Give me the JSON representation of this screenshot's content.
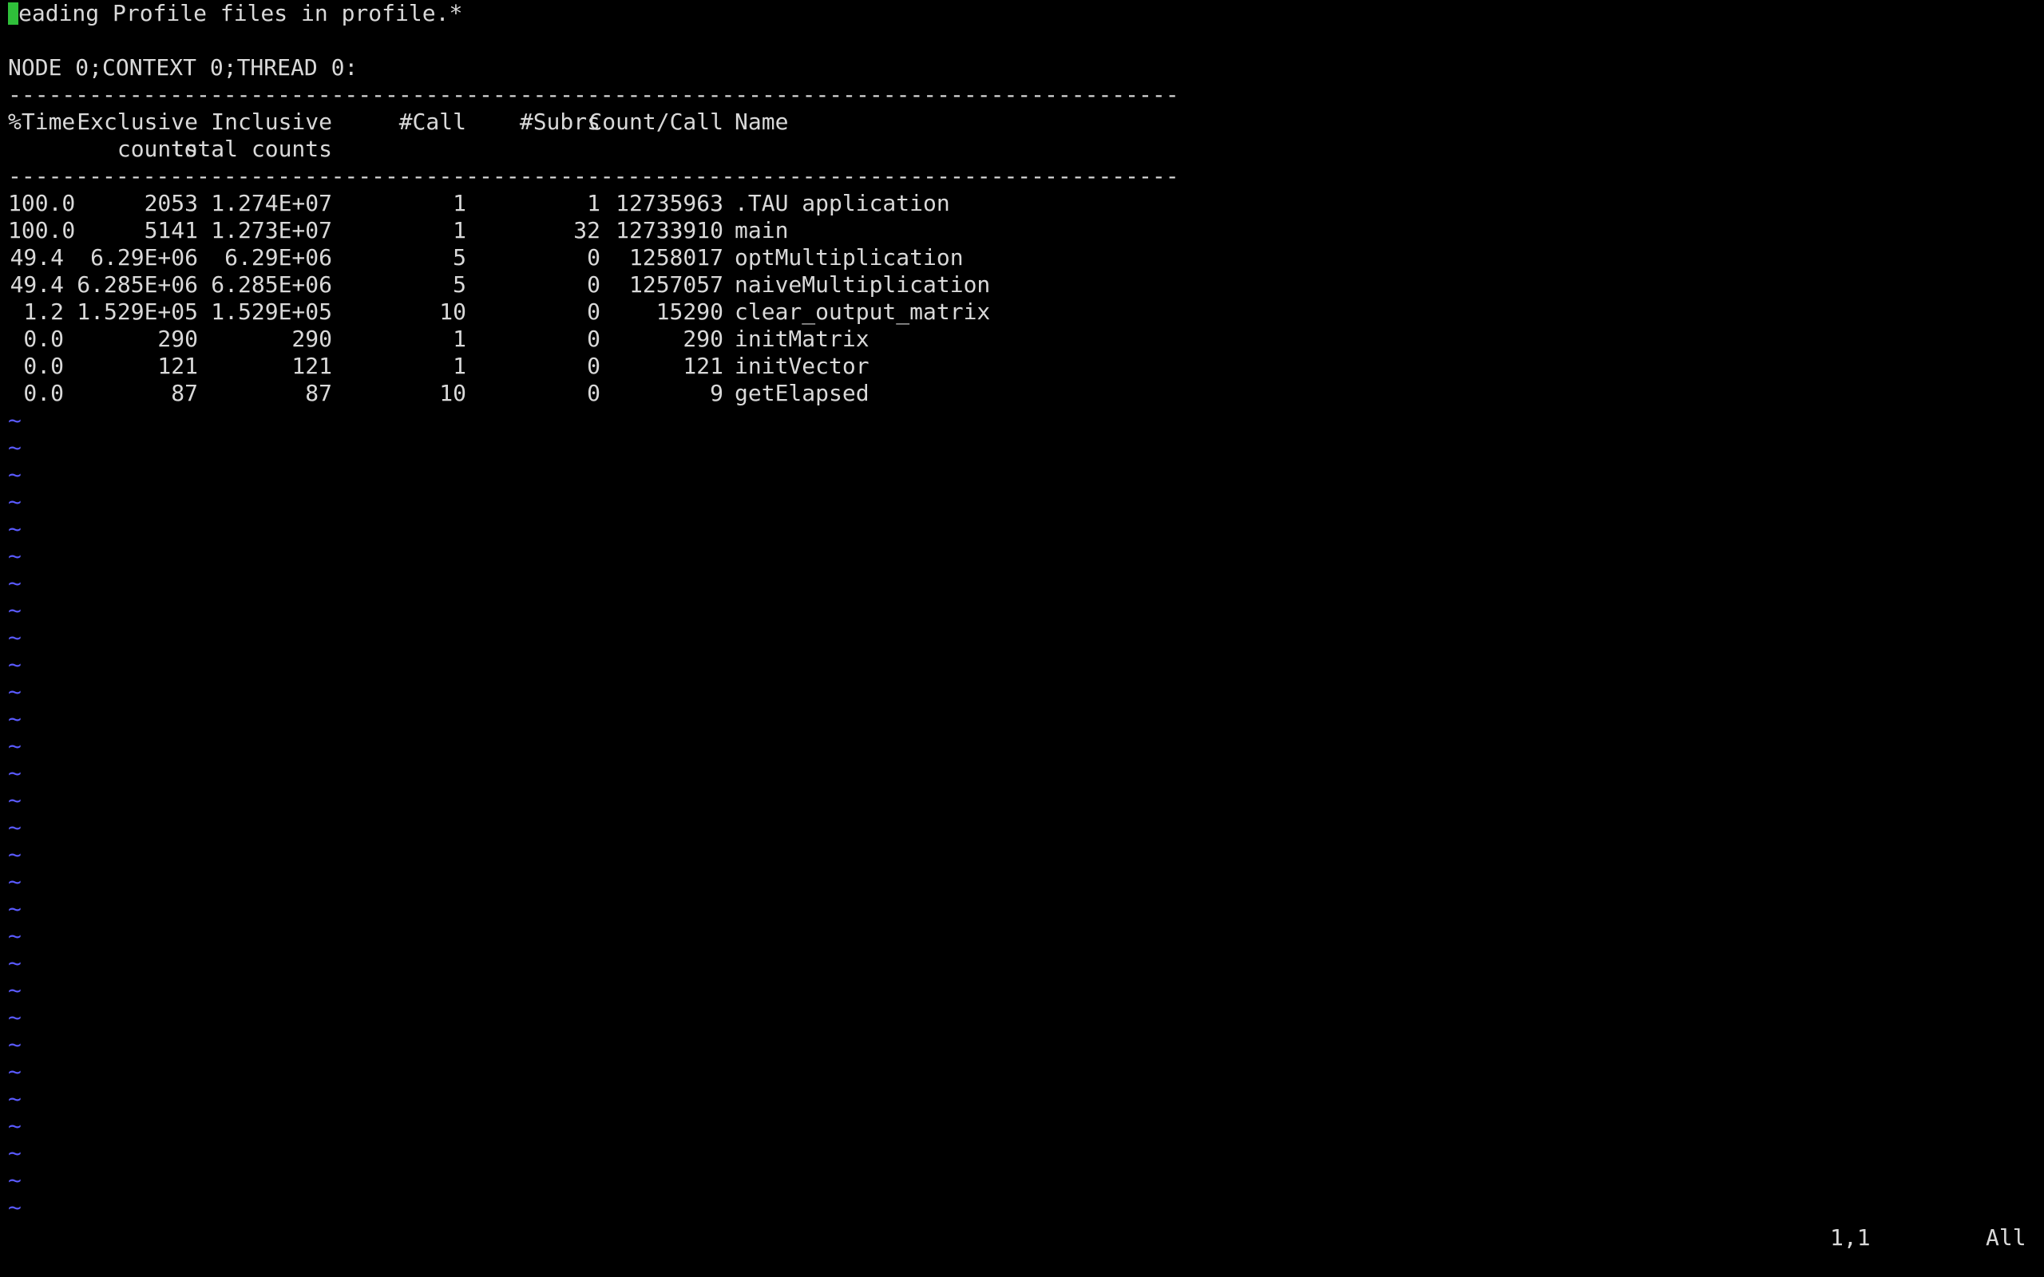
{
  "colors": {
    "background": "#000000",
    "text": "#d9d9d9",
    "cursor": "#2fbf3a",
    "tilde": "#5a5aff"
  },
  "message": "eading Profile files in profile.*",
  "context": "NODE 0;CONTEXT 0;THREAD 0:",
  "separator": "---------------------------------------------------------------------------------------",
  "headers": {
    "time": "%Time",
    "exclusive": "Exclusive",
    "inclusive": "Inclusive",
    "call": "#Call",
    "subrs": "#Subrs",
    "count_per_call": "Count/Call",
    "name": "Name",
    "exclusive_sub": "counts",
    "inclusive_sub": "total counts"
  },
  "rows": [
    {
      "time": "100.0",
      "exclusive": "2053",
      "inclusive": "1.274E+07",
      "call": "1",
      "subrs": "1",
      "count_per_call": "12735963",
      "name": ".TAU application"
    },
    {
      "time": "100.0",
      "exclusive": "5141",
      "inclusive": "1.273E+07",
      "call": "1",
      "subrs": "32",
      "count_per_call": "12733910",
      "name": "main"
    },
    {
      "time": "49.4",
      "exclusive": "6.29E+06",
      "inclusive": "6.29E+06",
      "call": "5",
      "subrs": "0",
      "count_per_call": "1258017",
      "name": "optMultiplication"
    },
    {
      "time": "49.4",
      "exclusive": "6.285E+06",
      "inclusive": "6.285E+06",
      "call": "5",
      "subrs": "0",
      "count_per_call": "1257057",
      "name": "naiveMultiplication"
    },
    {
      "time": "1.2",
      "exclusive": "1.529E+05",
      "inclusive": "1.529E+05",
      "call": "10",
      "subrs": "0",
      "count_per_call": "15290",
      "name": "clear_output_matrix"
    },
    {
      "time": "0.0",
      "exclusive": "290",
      "inclusive": "290",
      "call": "1",
      "subrs": "0",
      "count_per_call": "290",
      "name": "initMatrix"
    },
    {
      "time": "0.0",
      "exclusive": "121",
      "inclusive": "121",
      "call": "1",
      "subrs": "0",
      "count_per_call": "121",
      "name": "initVector"
    },
    {
      "time": "0.0",
      "exclusive": "87",
      "inclusive": "87",
      "call": "10",
      "subrs": "0",
      "count_per_call": "9",
      "name": "getElapsed"
    }
  ],
  "tilde": "~",
  "status": {
    "position": "1,1",
    "view": "All"
  }
}
